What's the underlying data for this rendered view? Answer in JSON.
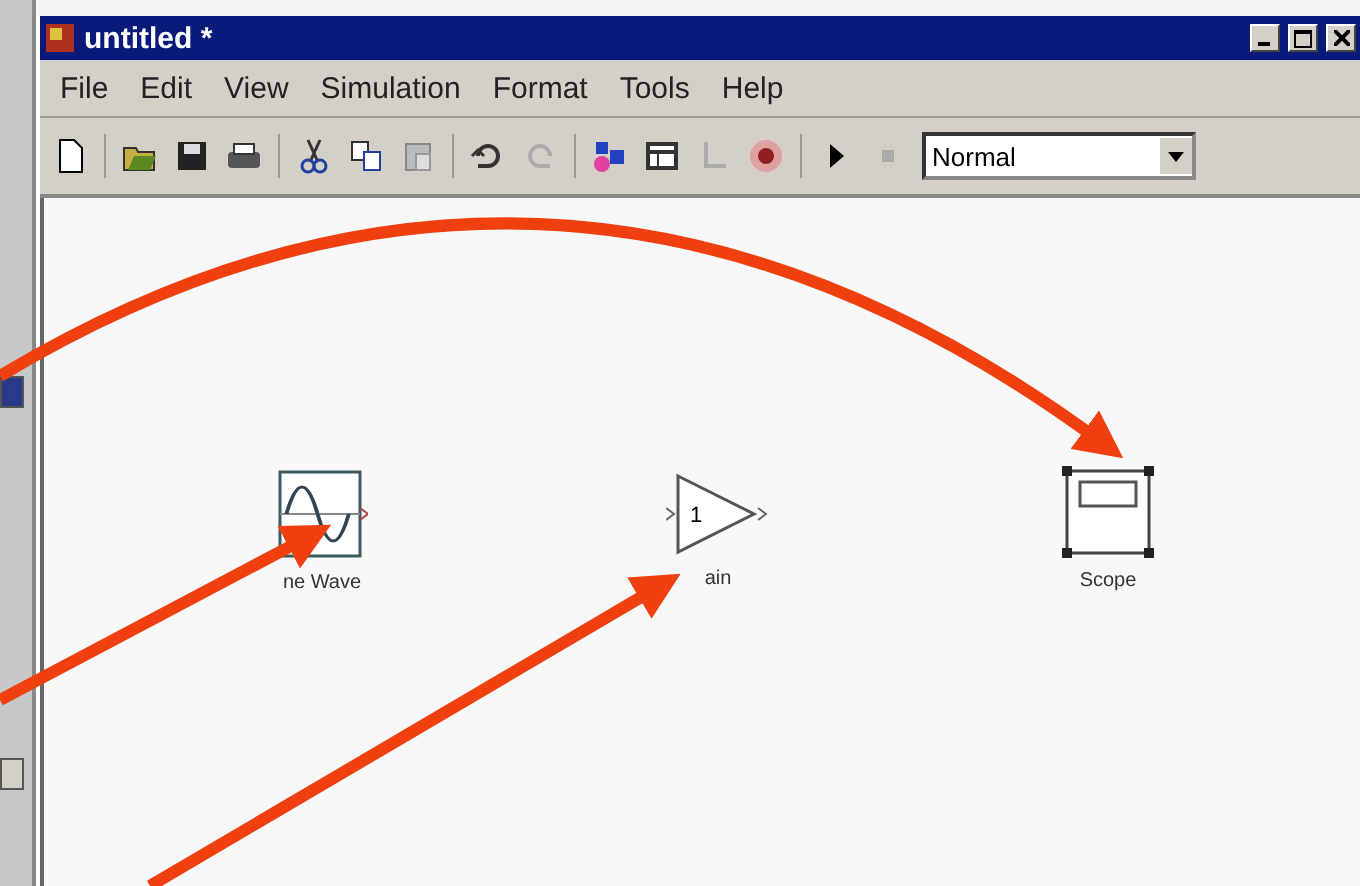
{
  "window": {
    "title": "untitled *"
  },
  "menu": [
    "File",
    "Edit",
    "View",
    "Simulation",
    "Format",
    "Tools",
    "Help"
  ],
  "toolbar": {
    "mode": "Normal"
  },
  "blocks": [
    {
      "kind": "sine",
      "label": "ne Wave",
      "selected": false
    },
    {
      "kind": "gain",
      "label": "ain",
      "value": "1",
      "selected": false
    },
    {
      "kind": "scope",
      "label": "Scope",
      "selected": true
    }
  ]
}
